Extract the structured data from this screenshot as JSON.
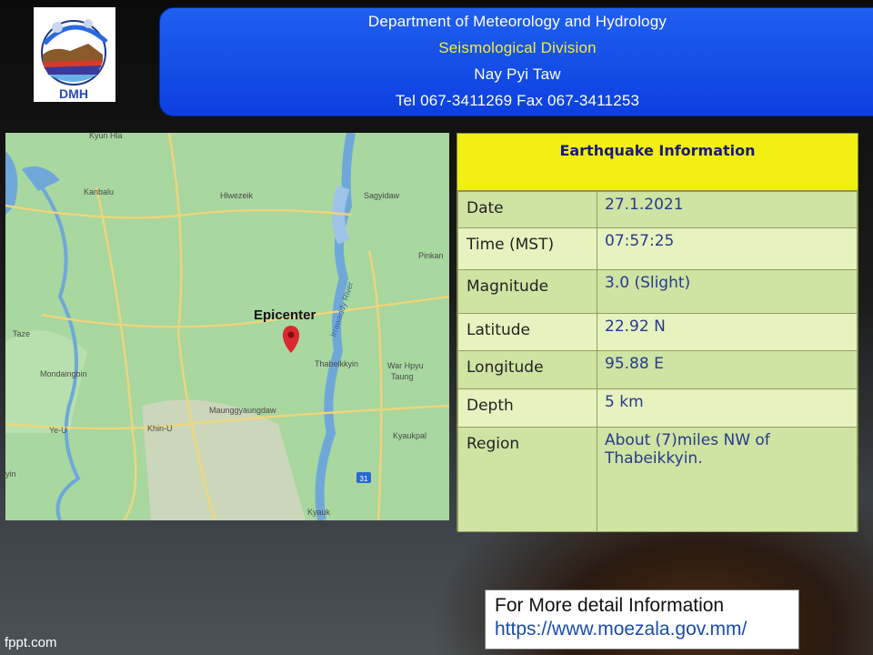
{
  "logo": {
    "text": "DMH"
  },
  "header": {
    "department": "Department of Meteorology and Hydrology",
    "division": "Seismological Division",
    "city": "Nay Pyi Taw",
    "contact": "Tel 067-3411269 Fax 067-3411253"
  },
  "map": {
    "epicenter_label": "Epicenter",
    "river_label": "Irrawaddy River",
    "highway_number": "31",
    "places": {
      "kyun_hla": "Kyun Hla",
      "kanbalu": "Kanbalu",
      "hlwezeik": "Hlwezeik",
      "sagyidaw": "Sagyidaw",
      "pinkan": "Pinkan",
      "taze": "Taze",
      "mondaingbin": "Mondaingbin",
      "thabeikkyin": "Thabeikkyin",
      "war_hpyu_taung": "War Hpyu",
      "war_hpyu_taung2": "Taung",
      "maunggyaungdaw": "Maunggyaungdaw",
      "ye_u": "Ye-U",
      "khin_u": "Khin-U",
      "kyaukpal": "Kyaukpal",
      "kyauk": "Kyauk",
      "left_edge": "yin"
    }
  },
  "info": {
    "title": "Earthquake  Information",
    "rows": [
      {
        "label": "Date",
        "value": "27.1.2021"
      },
      {
        "label": "Time (MST)",
        "value": "07:57:25"
      },
      {
        "label": "Magnitude",
        "value": "3.0  (Slight)"
      },
      {
        "label": "Latitude",
        "value": "22.92  N"
      },
      {
        "label": "Longitude",
        "value": "95.88  E"
      },
      {
        "label": "Depth",
        "value": "5 km"
      },
      {
        "label": "Region",
        "value": "About  (7)miles  NW of Thabeikkyin."
      }
    ]
  },
  "footer": {
    "more_info": "For More detail Information",
    "url": "https://www.moezala.gov.mm/",
    "watermark": "fppt.com"
  },
  "colors": {
    "header_bg": "#0d3fe0",
    "division_text": "#f3ef2b",
    "info_title_bg": "#f2ef12",
    "info_row_light": "#e6f3bf",
    "info_row_dark": "#cfe3a3",
    "map_land": "#a8d7a0",
    "map_water": "#6fa8d8",
    "epicenter_pin": "#d9282f"
  }
}
